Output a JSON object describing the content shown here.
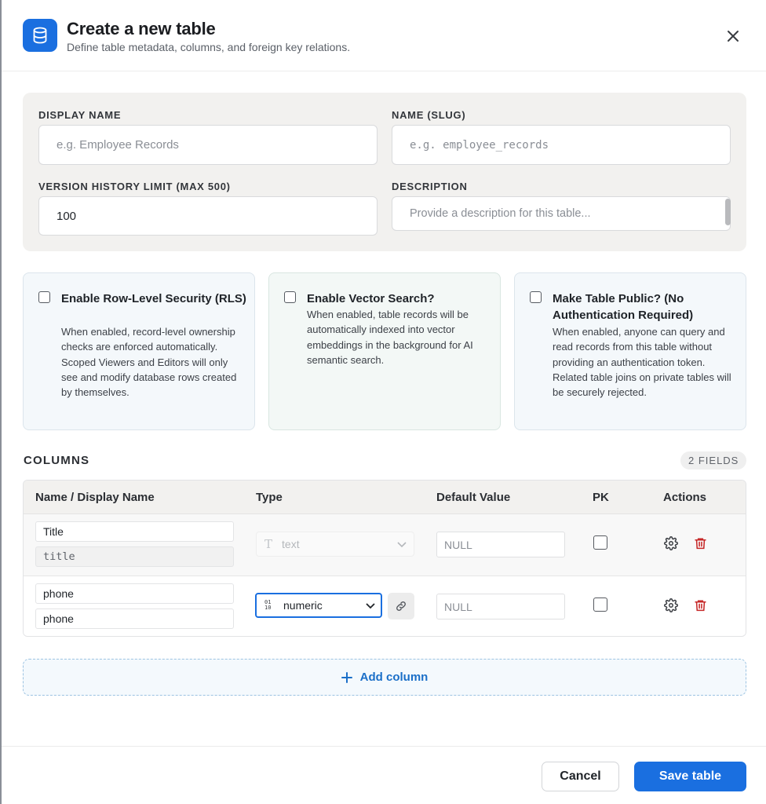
{
  "header": {
    "title": "Create a new table",
    "subtitle": "Define table metadata, columns, and foreign key relations."
  },
  "metadata": {
    "display_name": {
      "label": "DISPLAY NAME",
      "value": "",
      "placeholder": "e.g. Employee Records"
    },
    "slug": {
      "label": "NAME (SLUG)",
      "value": "",
      "placeholder": "e.g. employee_records"
    },
    "version_limit": {
      "label": "VERSION HISTORY LIMIT (MAX 500)",
      "value": "100"
    },
    "description": {
      "label": "DESCRIPTION",
      "value": "",
      "placeholder": "Provide a description for this table..."
    }
  },
  "options": [
    {
      "title": "Enable Row-Level Security (RLS)",
      "description": "When enabled, record-level ownership checks are enforced automatically. Scoped Viewers and Editors will only see and modify database rows created by themselves.",
      "checked": false
    },
    {
      "title": "Enable Vector Search?",
      "description": "When enabled, table records will be automatically indexed into vector embeddings in the background for AI semantic search.",
      "checked": false
    },
    {
      "title": "Make Table Public? (No Authentication Required)",
      "description": "When enabled, anyone can query and read records from this table without providing an authentication token. Related table joins on private tables will be securely rejected.",
      "checked": false
    }
  ],
  "columns": {
    "title": "COLUMNS",
    "count_badge": "2 FIELDS",
    "headers": [
      "Name / Display Name",
      "Type",
      "Default Value",
      "PK",
      "Actions"
    ],
    "rows": [
      {
        "display_name": "Title",
        "name": "title",
        "type": "text",
        "type_icon": "text-type-icon",
        "type_enabled": false,
        "default_placeholder": "NULL",
        "pk": false
      },
      {
        "display_name": "phone",
        "name": "phone",
        "type": "numeric",
        "type_icon": "numeric-type-icon",
        "type_enabled": true,
        "default_placeholder": "NULL",
        "pk": false
      }
    ],
    "add_label": "Add column"
  },
  "footer": {
    "cancel_label": "Cancel",
    "save_label": "Save table"
  },
  "colors": {
    "accent": "#1a6fe0",
    "danger": "#c62828",
    "panel": "#f2f1ef"
  }
}
